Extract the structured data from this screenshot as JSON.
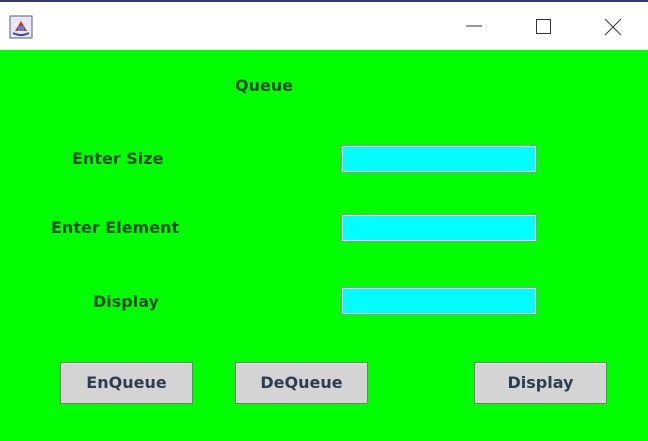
{
  "window": {
    "app_icon": "java-coffee-cup-icon",
    "controls": [
      "minimize-icon",
      "maximize-icon",
      "close-icon"
    ]
  },
  "form": {
    "title": "Queue",
    "size_label": "Enter Size",
    "element_label": "Enter Element",
    "display_label": "Display",
    "size_value": "",
    "element_value": "",
    "display_value": ""
  },
  "buttons": {
    "enqueue": "EnQueue",
    "dequeue": "DeQueue",
    "display": "Display"
  },
  "colors": {
    "background": "#00ff00",
    "field_background": "#00ffff",
    "label_text": "#1e4e1e",
    "button_background": "#d4d4d4"
  }
}
